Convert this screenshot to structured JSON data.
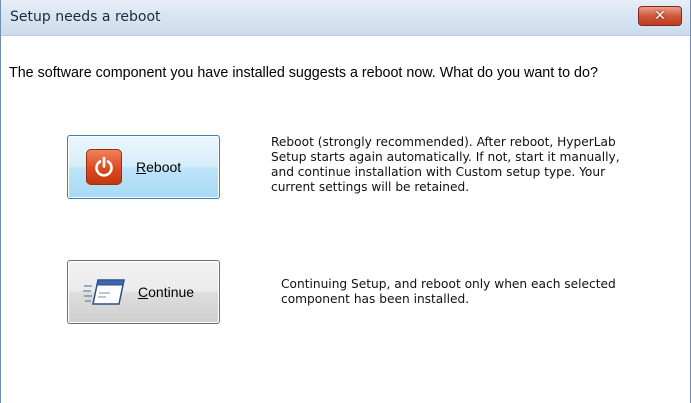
{
  "dialog": {
    "title": "Setup needs a reboot",
    "close_glyph": "✕",
    "prompt": "The software component you have installed suggests a reboot now. What do you want to do?"
  },
  "reboot": {
    "label_mnemonic": "R",
    "label_rest": "eboot",
    "icon": "power-icon",
    "description_lines": [
      "Reboot (strongly recommended). After reboot, HyperLab",
      "Setup starts again automatically. If not, start it manually,",
      "and continue installation with Custom setup type. Your",
      "current settings will be retained."
    ]
  },
  "continue": {
    "label_mnemonic": "C",
    "label_rest": "ontinue",
    "icon": "window-icon",
    "description_lines": [
      "Continuing Setup, and reboot only when each selected",
      "component has been installed."
    ]
  },
  "colors": {
    "titlebar": "#d8e4f2",
    "close_button": "#c8452a",
    "reboot_button": "#bde4f8",
    "power_icon": "#dd4a22"
  }
}
